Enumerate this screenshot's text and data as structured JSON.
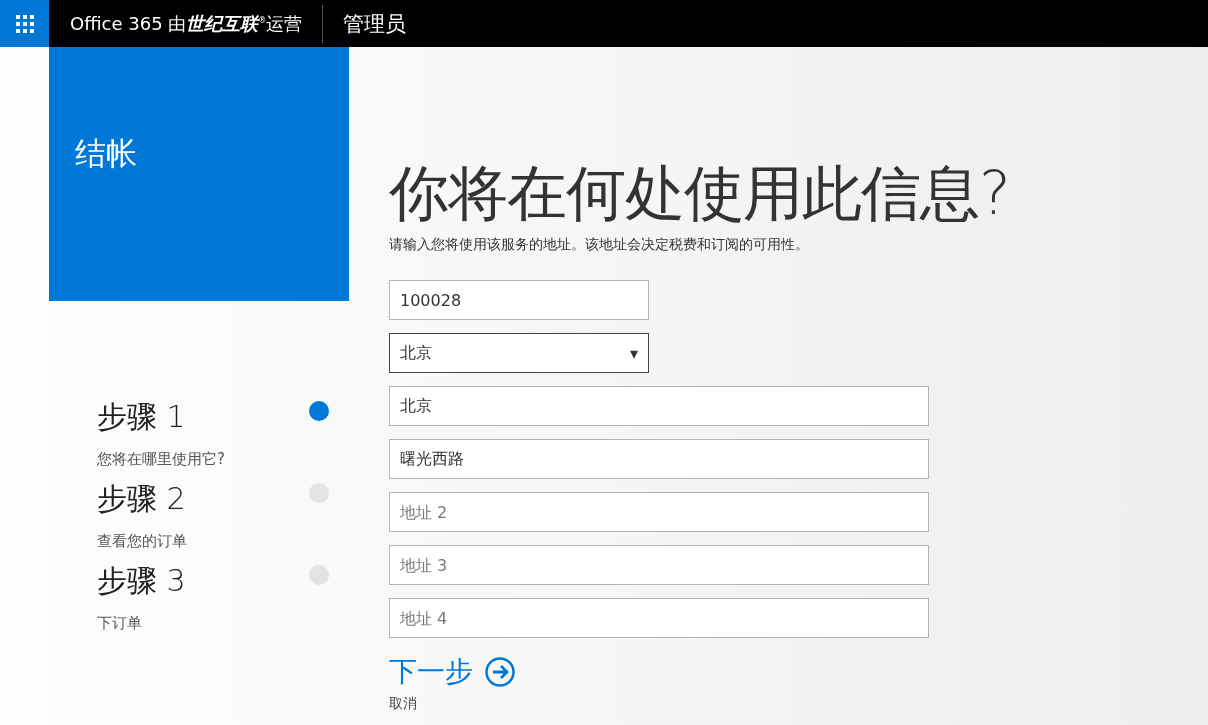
{
  "header": {
    "brand": "Office 365 由**世纪互联**$^{®}$运营",
    "section": "管理员"
  },
  "panel": {
    "title": "结帐"
  },
  "steps": [
    {
      "title": "步骤 1",
      "subtitle": "您将在哪里使用它?",
      "selected": true
    },
    {
      "title": "步骤 2",
      "subtitle": "查看您的订单",
      "selected": false
    },
    {
      "title": "步骤 3",
      "subtitle": "下订单",
      "selected": false
    }
  ],
  "heading": "你将在何处使用此信息?",
  "description": "请输入您将使用该服务的地址。该地址会决定税费和订阅的可用性。",
  "fields": [
    {
      "kind": "postcode",
      "value": "100028"
    },
    {
      "kind": "select",
      "value": "北京",
      "arrow": "▾"
    },
    {
      "kind": "text",
      "value": "北京"
    },
    {
      "kind": "text",
      "value": "曙光西路"
    },
    {
      "kind": "text",
      "placeholder": "地址 2"
    },
    {
      "kind": "text",
      "placeholder": "地址 3"
    },
    {
      "kind": "text",
      "placeholder": "地址 4"
    }
  ],
  "next": "下一步",
  "cancel": "取消"
}
